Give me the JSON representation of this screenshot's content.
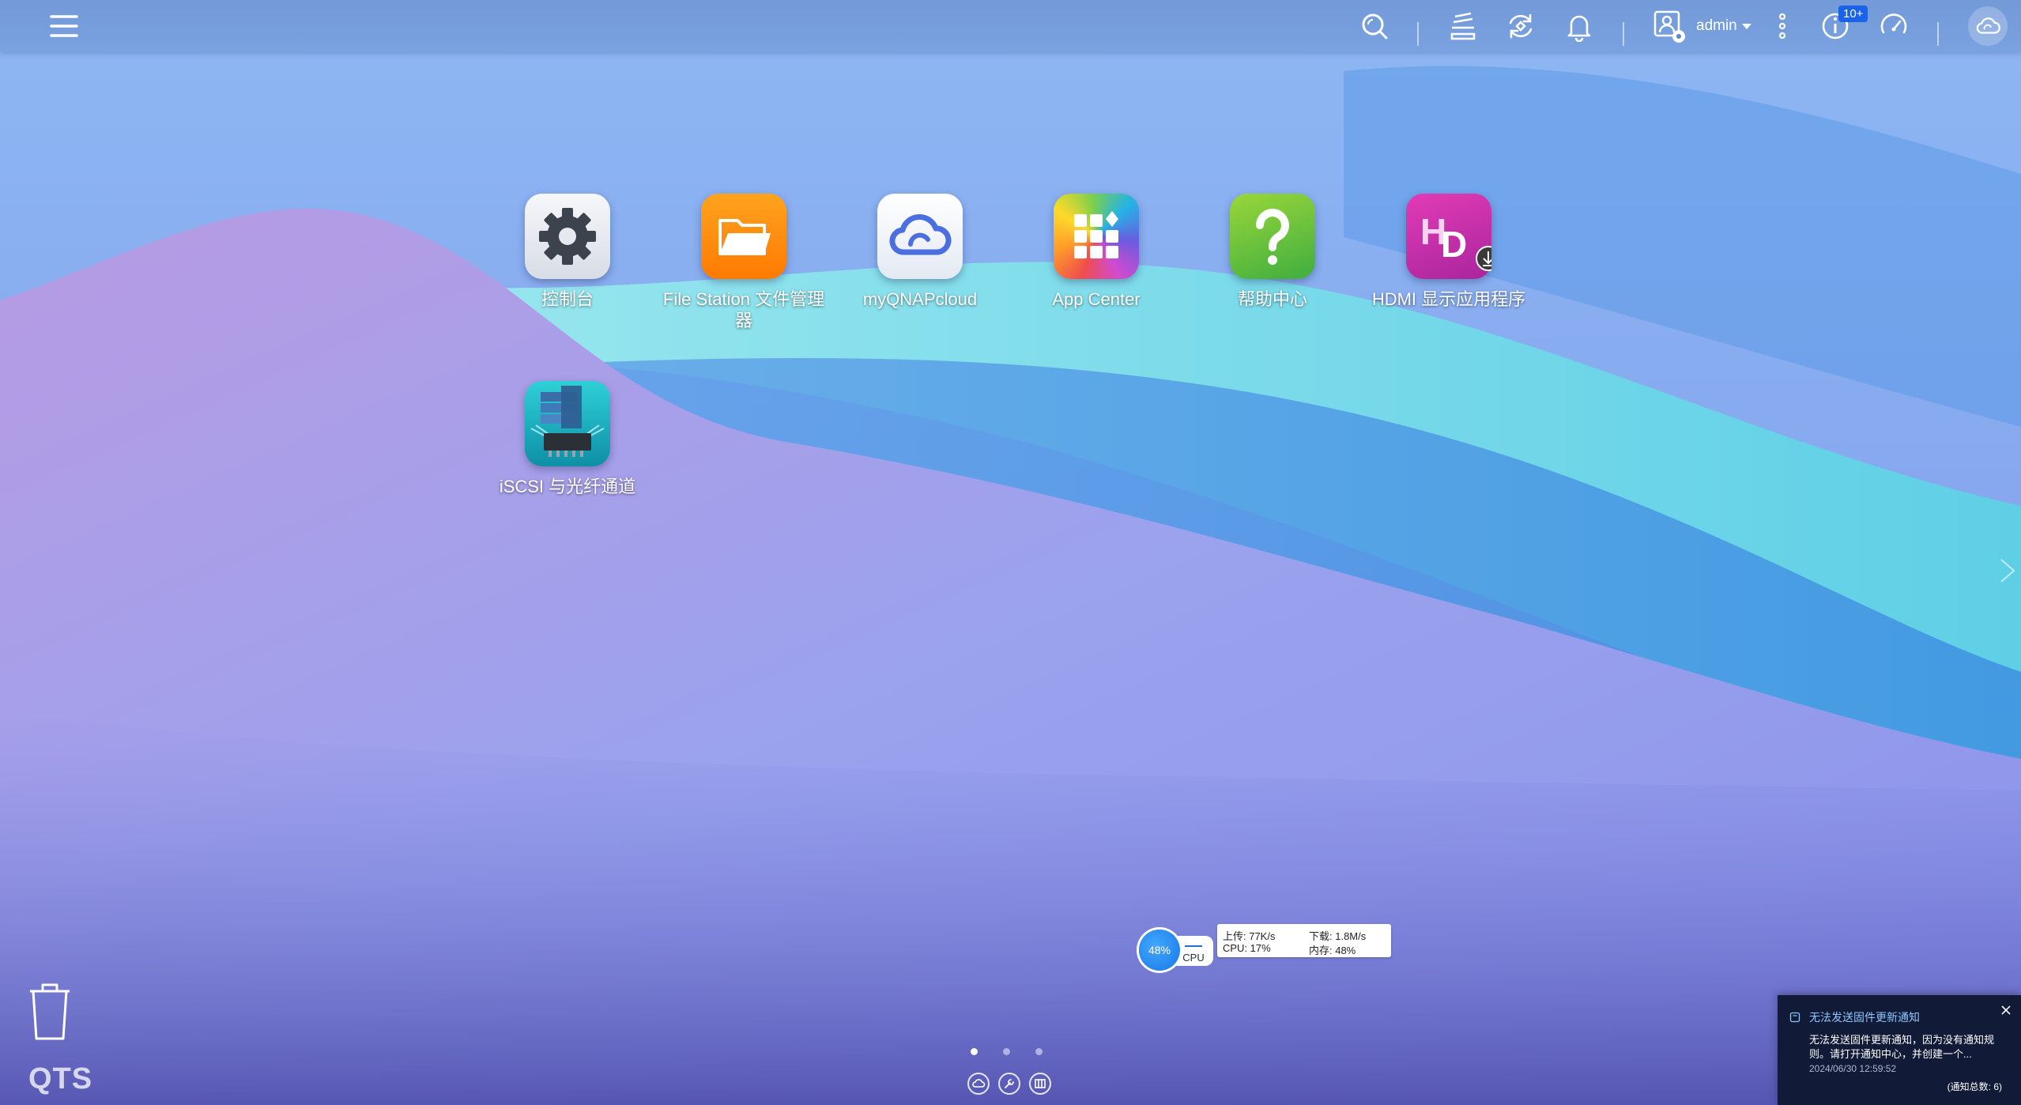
{
  "topbar": {
    "user": "admin",
    "notification_badge": "10+"
  },
  "desktop": {
    "apps": [
      {
        "label": "控制台",
        "icon": "gear-icon",
        "color": "#e9ecf2"
      },
      {
        "label": "File Station 文件管理器",
        "icon": "folder-icon",
        "color": "#ff8a00"
      },
      {
        "label": "myQNAPcloud",
        "icon": "cloud-icon",
        "color": "#f4f7fc"
      },
      {
        "label": "App Center",
        "icon": "app-grid-icon",
        "color": "#e8553a"
      },
      {
        "label": "帮助中心",
        "icon": "question-icon",
        "color": "#5fbf3a"
      },
      {
        "label": "HDMI 显示应用程序",
        "icon": "hd-icon",
        "color": "#c42aa8"
      },
      {
        "label": "iSCSI 与光纤通道",
        "icon": "iscsi-icon",
        "color": "#1fb8c8"
      }
    ],
    "brand": "QTS",
    "pages": 3,
    "active_page": 1
  },
  "resource": {
    "gauge_value": "48%",
    "gauge_label": "CPU",
    "upload": "上传: 77K/s",
    "download": "下载: 1.8M/s",
    "cpu": "CPU: 17%",
    "memory": "内存: 48%"
  },
  "notification": {
    "title": "无法发送固件更新通知",
    "body": "无法发送固件更新通知，因为没有通知规则。请打开通知中心，并创建一个...",
    "time": "2024/06/30 12:59:52",
    "count": "(通知总数: 6)"
  }
}
